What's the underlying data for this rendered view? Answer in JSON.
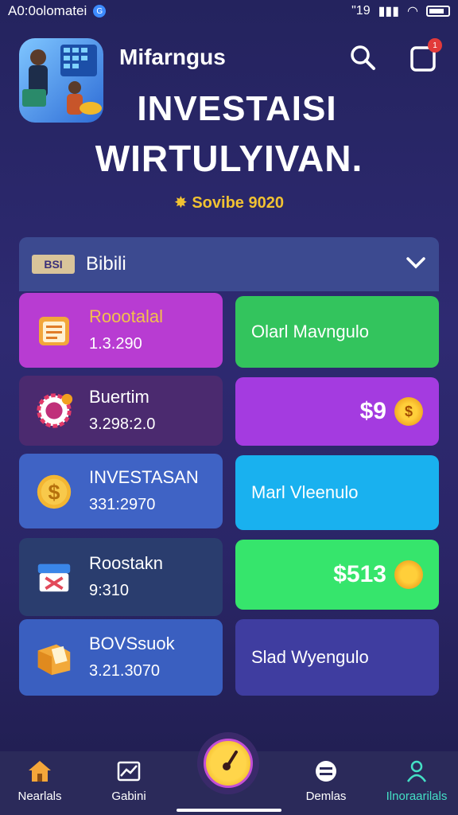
{
  "status_bar": {
    "time_text": "A0:0olomatei",
    "icons": [
      "g-badge-icon",
      "signal-icon",
      "wifi-icon",
      "battery-icon"
    ],
    "right_text": "\"19"
  },
  "header": {
    "app_name": "Mifarngus",
    "title_line1": "INVESTAISI",
    "title_line2": "WIRTULYIVAN.",
    "promo": "Sovibe 9020",
    "notification_count": "1"
  },
  "dropdown": {
    "chip": "BSI",
    "label": "Bibili"
  },
  "left_cards": [
    {
      "title": "Roootalal",
      "value": "1.3.290",
      "icon": "notepad-icon",
      "bg": "#b83cd2",
      "title_color": "#f3c04b"
    },
    {
      "title": "Buertim",
      "value": "3.298:2.0",
      "icon": "gear-coin-icon",
      "bg": "#4b2a6f",
      "title_color": "#ffffff"
    },
    {
      "title": "INVESTASAN",
      "value": "331:2970",
      "icon": "dollar-coin-icon",
      "bg": "#3f63c5",
      "title_color": "#ffffff"
    },
    {
      "title": "Roostakn",
      "value": "9:310",
      "icon": "bank-icon",
      "bg": "#2a3d6e",
      "title_color": "#ffffff"
    },
    {
      "title": "BOVSsuok",
      "value": "3.21.3070",
      "icon": "box-icon",
      "bg": "#3a5fc0",
      "title_color": "#ffffff"
    }
  ],
  "right_cards": [
    {
      "text": "Olarl Mavngulo",
      "bg": "#33c45d"
    },
    {
      "text": "$9",
      "bg": "#a43be0",
      "coin": "$"
    },
    {
      "text": "Marl Vleenulo",
      "bg": "#19b1ef"
    },
    {
      "text": "$513",
      "bg": "#36e56c",
      "coin": ""
    },
    {
      "text": "Slad Wyengulo",
      "bg": "#3f3da0"
    }
  ],
  "bottom_nav": [
    {
      "label": "Nearlals",
      "icon": "home-icon"
    },
    {
      "label": "Gabini",
      "icon": "chart-icon"
    },
    {
      "label": "Demlas",
      "icon": "menu-circle-icon"
    },
    {
      "label": "Ilnoraarilals",
      "icon": "person-icon",
      "color": "#44e0c5"
    }
  ],
  "colors": {
    "accent": "#f1c232",
    "background": "#2e2a72",
    "nav_bg": "#2b2a5a"
  }
}
